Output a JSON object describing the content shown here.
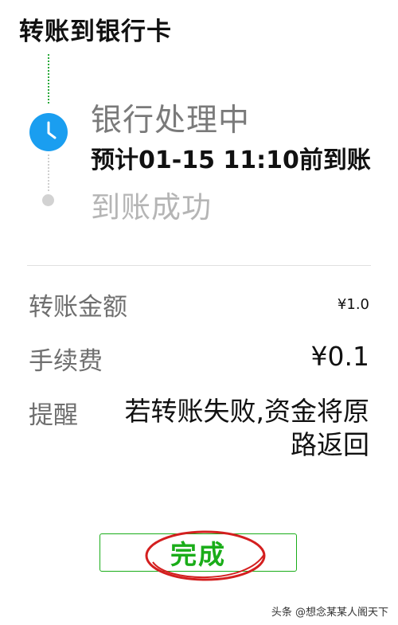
{
  "header": {
    "title": "转账到银行卡"
  },
  "status": {
    "processing_label": "银行处理中",
    "eta": "预计01-15 11:10前到账",
    "success_label": "到账成功"
  },
  "details": {
    "amount_label": "转账金额",
    "amount_value": "¥1.0",
    "fee_label": "手续费",
    "fee_value": "¥0.1",
    "reminder_label": "提醒",
    "reminder_text": "若转账失败,资金将原路返回"
  },
  "actions": {
    "done_label": "完成"
  },
  "watermark": {
    "text": "头条 @想念某某人阁天下"
  },
  "icons": {
    "processing": "clock-icon",
    "pending_step": "dot-icon"
  },
  "colors": {
    "accent_blue": "#1a9ef0",
    "button_green": "#1aad19",
    "annotation_red": "#d41f1f"
  }
}
